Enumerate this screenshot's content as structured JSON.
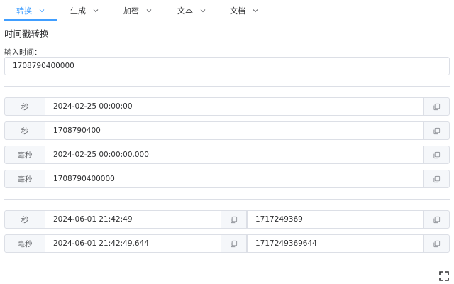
{
  "tabs": [
    {
      "label": "转换",
      "active": true
    },
    {
      "label": "生成",
      "active": false
    },
    {
      "label": "加密",
      "active": false
    },
    {
      "label": "文本",
      "active": false
    },
    {
      "label": "文档",
      "active": false
    }
  ],
  "page_title": "时间戳转换",
  "input": {
    "label": "输入时间：",
    "value": "1708790400000"
  },
  "results": [
    {
      "unit": "秒",
      "value": "2024-02-25 00:00:00"
    },
    {
      "unit": "秒",
      "value": "1708790400"
    },
    {
      "unit": "毫秒",
      "value": "2024-02-25 00:00:00.000"
    },
    {
      "unit": "毫秒",
      "value": "1708790400000"
    }
  ],
  "current": [
    {
      "unit": "秒",
      "datetime": "2024-06-01 21:42:49",
      "timestamp": "1717249369"
    },
    {
      "unit": "毫秒",
      "datetime": "2024-06-01 21:42:49.644",
      "timestamp": "1717249369644"
    }
  ],
  "colors": {
    "accent": "#409eff",
    "border": "#dcdfe6",
    "addon_bg": "#f5f7fa",
    "text": "#303133"
  },
  "icons": {
    "tab_dropdown": "chevron-down-icon",
    "copy": "copy-icon",
    "fullscreen": "fullscreen-icon"
  }
}
